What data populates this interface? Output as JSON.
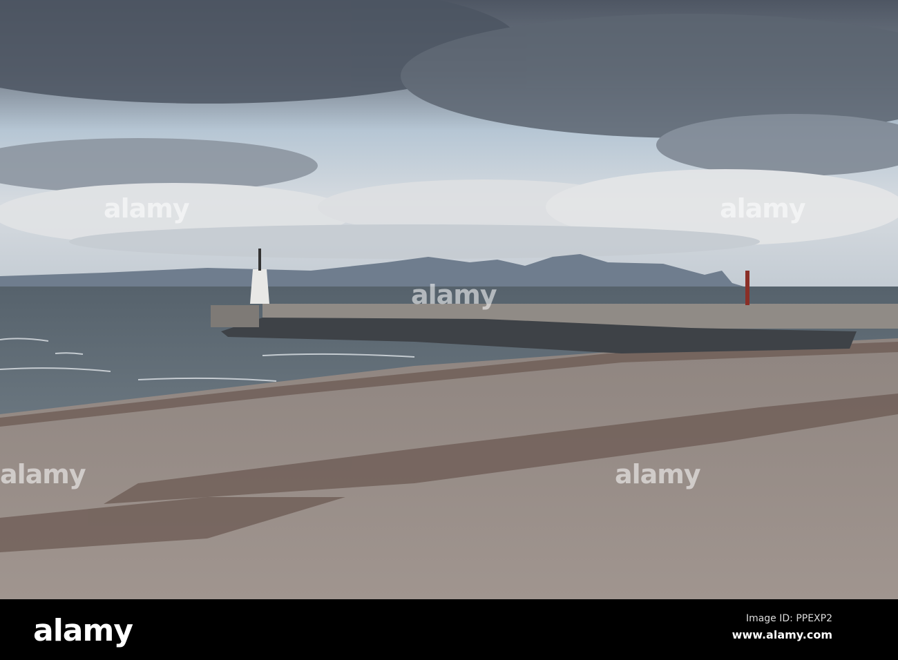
{
  "watermark": {
    "text": "alamy"
  },
  "footer": {
    "logo": "alamy",
    "image_id": "Image ID: PPEXP2",
    "url": "www.alamy.com"
  },
  "colors": {
    "sky": "#b9c4cf",
    "cloud_dark": "#5a6370",
    "sea": "#4e5a63",
    "sand": "#9c9089",
    "seaweed": "#6e5a52"
  }
}
